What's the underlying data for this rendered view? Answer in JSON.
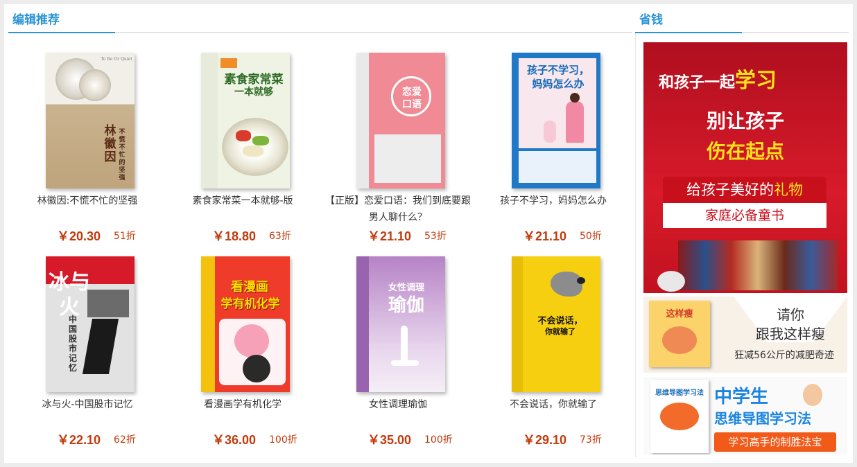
{
  "sections": {
    "editor_pick": "编辑推荐",
    "save_money": "省钱"
  },
  "books": [
    {
      "name": "林徽因:不慌不忙的坚强",
      "price": "￥20.30",
      "discount": "51折",
      "cover_text": "林徽因",
      "cover_sub": "不慌不忙的坚强",
      "cover_en": "To Be Or Quiet",
      "cover_bg": "#d9cbb4"
    },
    {
      "name": "素食家常菜一本就够-版",
      "price": "￥18.80",
      "discount": "63折",
      "cover_text": "素食家常菜",
      "cover_sub": "一本就够",
      "cover_en": "",
      "cover_bg": "#eef3e4"
    },
    {
      "name": "【正版】恋爱口语：我们到底要跟男人聊什么？",
      "price": "￥21.10",
      "discount": "53折",
      "cover_text": "恋爱",
      "cover_sub": "口语",
      "cover_en": "",
      "cover_bg": "#f08a95"
    },
    {
      "name": "孩子不学习，妈妈怎么办",
      "price": "￥21.10",
      "discount": "50折",
      "cover_text": "孩子不学习，",
      "cover_sub": "妈妈怎么办",
      "cover_en": "",
      "cover_bg": "#1f79c8"
    },
    {
      "name": "冰与火-中国股市记忆",
      "price": "￥22.10",
      "discount": "62折",
      "cover_text": "冰与火",
      "cover_sub": "中国股市记忆",
      "cover_en": "",
      "cover_bg": "#e2e2e2"
    },
    {
      "name": "看漫画学有机化学",
      "price": "￥36.00",
      "discount": "100折",
      "cover_text": "看漫画",
      "cover_sub": "学有机化学",
      "cover_en": "",
      "cover_bg": "#ef3b2a"
    },
    {
      "name": "女性调理瑜伽",
      "price": "￥35.00",
      "discount": "100折",
      "cover_text": "女性调理",
      "cover_sub": "瑜伽",
      "cover_en": "",
      "cover_bg": "#b683c6"
    },
    {
      "name": "不会说话，你就输了",
      "price": "￥29.10",
      "discount": "73折",
      "cover_text": "不会说话，",
      "cover_sub": "你就输了",
      "cover_en": "",
      "cover_bg": "#f6cf10"
    }
  ],
  "ads": {
    "ad1": {
      "l1a": "和孩子一起",
      "l1b": "学习",
      "l2": "别让孩子",
      "l3": "伤在起点",
      "l4a": "给孩子美好的",
      "l4b": "礼物",
      "l5": "家庭必备童书"
    },
    "ad2": {
      "l1": "请你",
      "l2": "跟我这样瘦",
      "l3": "狂减56公斤的减肥奇迹",
      "cover": "这样瘦"
    },
    "ad3": {
      "l1": "中学生",
      "l2": "思维导图学习法",
      "l3": "学习高手的制胜法宝",
      "cover": "思维导图学习法"
    }
  }
}
